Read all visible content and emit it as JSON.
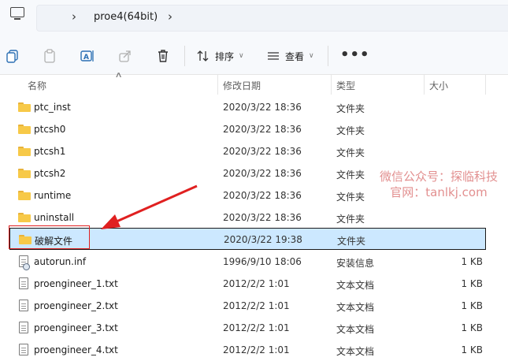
{
  "address_bar": {
    "path_segment": "proe4(64bit)"
  },
  "toolbar": {
    "sort_label": "排序",
    "view_label": "查看"
  },
  "columns": {
    "name": "名称",
    "modified": "修改日期",
    "type": "类型",
    "size": "大小"
  },
  "files": [
    {
      "name": "ptc_inst",
      "modified": "2020/3/22 18:36",
      "type": "文件夹",
      "size": "",
      "kind": "folder"
    },
    {
      "name": "ptcsh0",
      "modified": "2020/3/22 18:36",
      "type": "文件夹",
      "size": "",
      "kind": "folder"
    },
    {
      "name": "ptcsh1",
      "modified": "2020/3/22 18:36",
      "type": "文件夹",
      "size": "",
      "kind": "folder"
    },
    {
      "name": "ptcsh2",
      "modified": "2020/3/22 18:36",
      "type": "文件夹",
      "size": "",
      "kind": "folder"
    },
    {
      "name": "runtime",
      "modified": "2020/3/22 18:36",
      "type": "文件夹",
      "size": "",
      "kind": "folder"
    },
    {
      "name": "uninstall",
      "modified": "2020/3/22 18:36",
      "type": "文件夹",
      "size": "",
      "kind": "folder"
    },
    {
      "name": "破解文件",
      "modified": "2020/3/22 19:38",
      "type": "文件夹",
      "size": "",
      "kind": "folder",
      "selected": true
    },
    {
      "name": "autorun.inf",
      "modified": "1996/9/10 18:06",
      "type": "安装信息",
      "size": "1 KB",
      "kind": "inf"
    },
    {
      "name": "proengineer_1.txt",
      "modified": "2012/2/2 1:01",
      "type": "文本文档",
      "size": "1 KB",
      "kind": "txt"
    },
    {
      "name": "proengineer_2.txt",
      "modified": "2012/2/2 1:01",
      "type": "文本文档",
      "size": "1 KB",
      "kind": "txt"
    },
    {
      "name": "proengineer_3.txt",
      "modified": "2012/2/2 1:01",
      "type": "文本文档",
      "size": "1 KB",
      "kind": "txt"
    },
    {
      "name": "proengineer_4.txt",
      "modified": "2012/2/2 1:01",
      "type": "文本文档",
      "size": "1 KB",
      "kind": "txt"
    }
  ],
  "watermark": {
    "line1": "微信公众号：探临科技",
    "line2": "官网：tanlkj.com"
  },
  "colors": {
    "selection": "#cce8ff",
    "folder": "#f7c948",
    "annotation": "#e02020"
  },
  "icons": [
    "pc-icon",
    "chevron-right-icon",
    "copy-icon",
    "paste-icon",
    "rename-icon",
    "share-icon",
    "delete-icon",
    "sort-icon",
    "view-icon",
    "more-icon",
    "folder-icon",
    "file-icon"
  ]
}
